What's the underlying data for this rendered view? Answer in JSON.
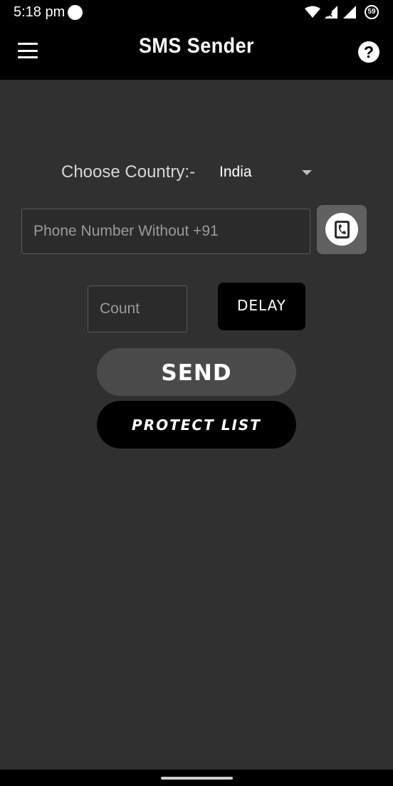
{
  "status_bar": {
    "time": "5:18 pm",
    "battery_level": "59",
    "icons": [
      "wifi-icon",
      "signal-icon",
      "signal-icon",
      "battery-icon"
    ]
  },
  "app_bar": {
    "title": "SMS Sender",
    "menu_icon": "menu-icon",
    "help_label": "?"
  },
  "form": {
    "country_label": "Choose Country:-",
    "country_value": "India",
    "phone_placeholder": "Phone Number Without +91",
    "phone_value": "",
    "count_placeholder": "Count",
    "count_value": "",
    "delay_label": "DELAY",
    "send_label": "SEND",
    "protect_label": "PROTECT LIST"
  },
  "colors": {
    "background": "#303030",
    "bar": "#000000",
    "send_button": "#4a4a4a",
    "contacts_button": "#616161"
  }
}
